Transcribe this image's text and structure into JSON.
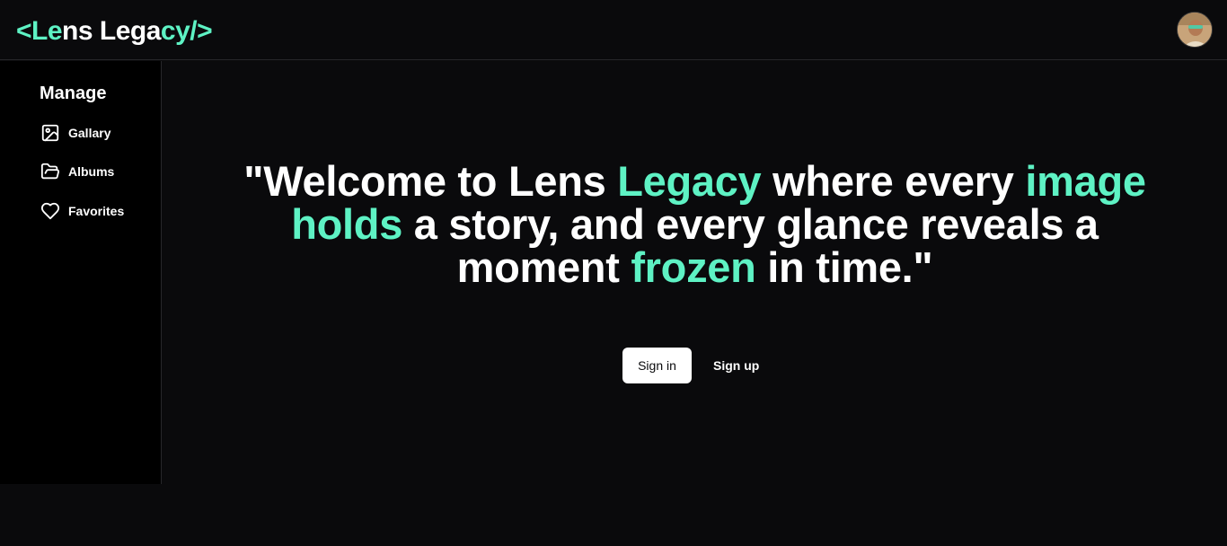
{
  "brand": {
    "open": "<",
    "part1": "Le",
    "part2": "ns Lega",
    "part3": "cy/>",
    "accent_color": "#5ef2c4"
  },
  "header": {
    "avatar_icon": "user-avatar"
  },
  "sidebar": {
    "title": "Manage",
    "items": [
      {
        "label": "Gallary",
        "icon": "image-icon"
      },
      {
        "label": "Albums",
        "icon": "folder-open-icon"
      },
      {
        "label": "Favorites",
        "icon": "heart-icon"
      }
    ]
  },
  "hero": {
    "line1_a": "\"Welcome to Lens ",
    "line1_b": "Legacy",
    "line1_c": " where every ",
    "line1_d": "image",
    "line2_a": "holds",
    "line2_b": " a story, and every glance reveals a",
    "line3_a": "moment ",
    "line3_b": "frozen",
    "line3_c": " in time.\""
  },
  "auth": {
    "signin_label": "Sign in",
    "signup_label": "Sign up"
  },
  "colors": {
    "background": "#0a0a0c",
    "sidebar": "#000000",
    "accent": "#5ef2c4"
  }
}
